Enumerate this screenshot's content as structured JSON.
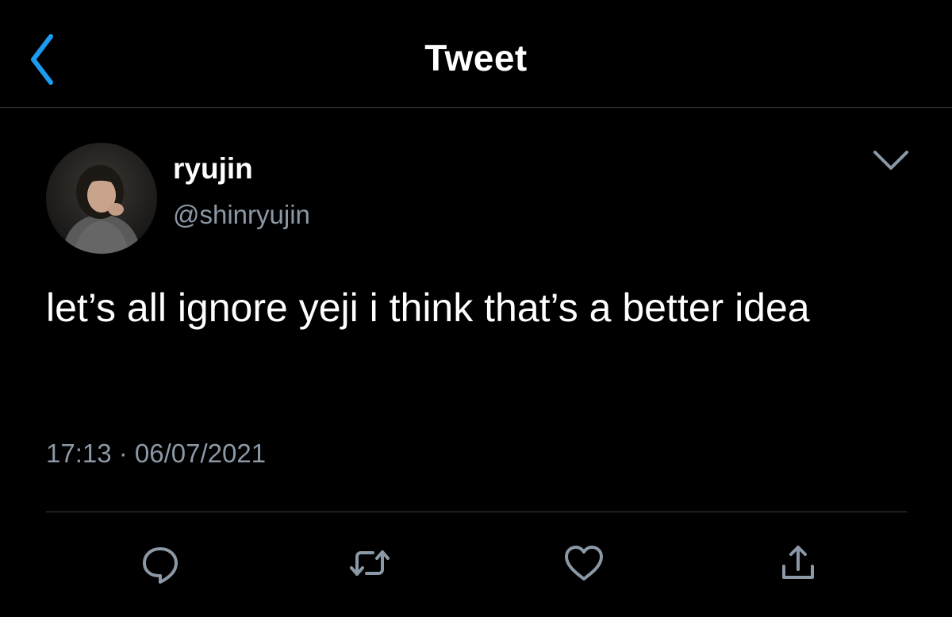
{
  "header": {
    "title": "Tweet",
    "back_icon": "chevron-left-icon"
  },
  "tweet": {
    "author": {
      "display_name": "ryujin",
      "handle": "@shinryujin"
    },
    "text": "let’s all ignore yeji i think that’s a better idea",
    "timestamp": "17:13 · 06/07/2021"
  },
  "actions": [
    {
      "name": "reply",
      "icon": "reply-icon"
    },
    {
      "name": "retweet",
      "icon": "retweet-icon"
    },
    {
      "name": "like",
      "icon": "heart-icon"
    },
    {
      "name": "share",
      "icon": "share-icon"
    }
  ],
  "colors": {
    "background": "#000000",
    "accent": "#1d9bf0",
    "secondary_text": "#8b98a5",
    "divider": "#3a3f44"
  }
}
